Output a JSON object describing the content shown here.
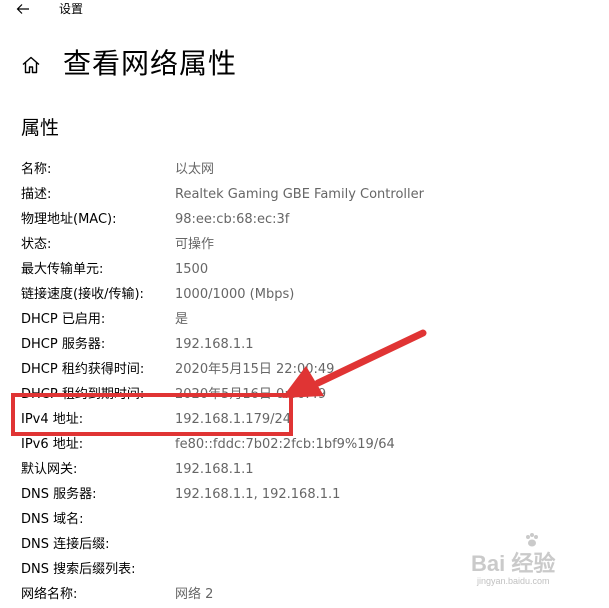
{
  "window": {
    "title": "设置"
  },
  "page": {
    "title": "查看网络属性",
    "section_title": "属性"
  },
  "properties": [
    {
      "label": "名称:",
      "value": "以太网"
    },
    {
      "label": "描述:",
      "value": "Realtek Gaming GBE Family Controller"
    },
    {
      "label": "物理地址(MAC):",
      "value": "98:ee:cb:68:ec:3f"
    },
    {
      "label": "状态:",
      "value": "可操作"
    },
    {
      "label": "最大传输单元:",
      "value": "1500"
    },
    {
      "label": "链接速度(接收/传输):",
      "value": "1000/1000 (Mbps)"
    },
    {
      "label": "DHCP 已启用:",
      "value": "是"
    },
    {
      "label": "DHCP 服务器:",
      "value": "192.168.1.1"
    },
    {
      "label": "DHCP 租约获得时间:",
      "value": "2020年5月15日 22:00:49"
    },
    {
      "label": "DHCP 租约到期时间:",
      "value": "2020年5月16日 0:00:49"
    },
    {
      "label": "IPv4 地址:",
      "value": "192.168.1.179/24"
    },
    {
      "label": "IPv6 地址:",
      "value": "fe80::fddc:7b02:2fcb:1bf9%19/64"
    },
    {
      "label": "默认网关:",
      "value": "192.168.1.1"
    },
    {
      "label": "DNS 服务器:",
      "value": "192.168.1.1, 192.168.1.1"
    },
    {
      "label": "DNS 域名:",
      "value": ""
    },
    {
      "label": "DNS 连接后缀:",
      "value": ""
    },
    {
      "label": "DNS 搜索后缀列表:",
      "value": ""
    },
    {
      "label": "网络名称:",
      "value": "网络 2"
    }
  ],
  "annotation": {
    "color": "#e03434"
  },
  "watermark": {
    "main": "Bai 经验",
    "sub": "jingyan.baidu.com"
  },
  "icons": {
    "back": "back-arrow-icon",
    "home": "home-icon"
  }
}
